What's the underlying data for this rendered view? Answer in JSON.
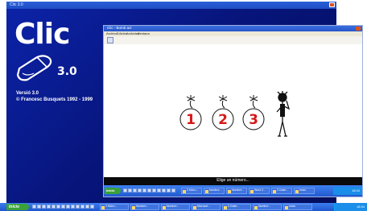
{
  "background_window": {
    "title": "Clic 3.0",
    "logo_text": "Clic",
    "logo_version": "3.0",
    "version_line": "Versió 3.0",
    "copyright_line": "© Francesc Busquets 1992 - 1999",
    "background_color": "#05147e"
  },
  "activity_window": {
    "title": "Clic - Bomb act",
    "menu": [
      "Archivo",
      "Edición",
      "Actividad",
      "Ventana"
    ],
    "bombs": [
      {
        "label": "1"
      },
      {
        "label": "2"
      },
      {
        "label": "3"
      }
    ],
    "instruction": "Elige un número...",
    "accent_color": "#d41818",
    "taskbar": {
      "start_label": "Inicio",
      "buttons": [
        "2 Micro...",
        "Nombre...",
        "Nombre...",
        "Word 2...",
        "3 Galer...",
        "Inicio"
      ],
      "clock": "18:34"
    }
  },
  "desktop_taskbar": {
    "start_label": "Inicio",
    "buttons": [
      "2 Micro...",
      "Nombre...",
      "Nombre...",
      "Microsof...",
      "3 Galer...",
      "Nombre...",
      "Inicio"
    ],
    "clock": "18:34"
  }
}
